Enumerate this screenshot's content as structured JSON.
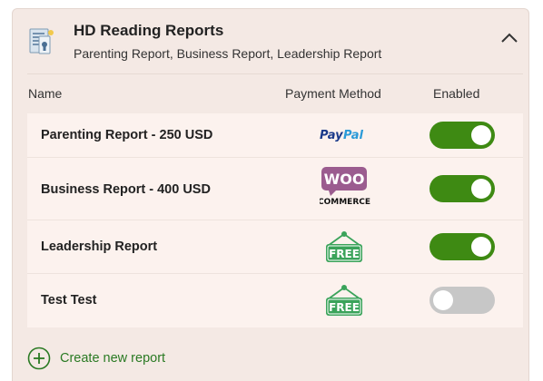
{
  "header": {
    "title": "HD Reading Reports",
    "subtitle": "Parenting Report, Business Report, Leadership Report",
    "icon": "report-list-icon",
    "collapse_icon": "chevron-up-icon"
  },
  "table": {
    "columns": [
      "Name",
      "Payment Method",
      "Enabled"
    ],
    "rows": [
      {
        "name": "Parenting Report - 250 USD",
        "payment": "PayPal",
        "payment_icon": "paypal-logo",
        "enabled": true
      },
      {
        "name": "Business Report - 400 USD",
        "payment": "WooCommerce",
        "payment_icon": "woocommerce-logo",
        "enabled": true
      },
      {
        "name": "Leadership Report",
        "payment": "FREE",
        "payment_icon": "free-tag-icon",
        "enabled": true
      },
      {
        "name": "Test Test",
        "payment": "FREE",
        "payment_icon": "free-tag-icon",
        "enabled": false
      }
    ]
  },
  "logos": {
    "paypal_a": "Pay",
    "paypal_b": "Pal",
    "woo_top": "WOO",
    "woo_bottom": "COMMERCE",
    "free": "FREE"
  },
  "actions": {
    "create_label": "Create new report",
    "create_icon": "plus-circle-icon"
  },
  "colors": {
    "card_bg": "#f4e9e4",
    "row_bg": "#fcf2ee",
    "toggle_on": "#3e8a13",
    "toggle_off": "#c7c7c7",
    "accent_green": "#2a7a23",
    "free_green": "#3aa35a",
    "woo_purple": "#9b5c8f",
    "paypal_dark": "#1a3a8a",
    "paypal_light": "#2a9ad8"
  }
}
